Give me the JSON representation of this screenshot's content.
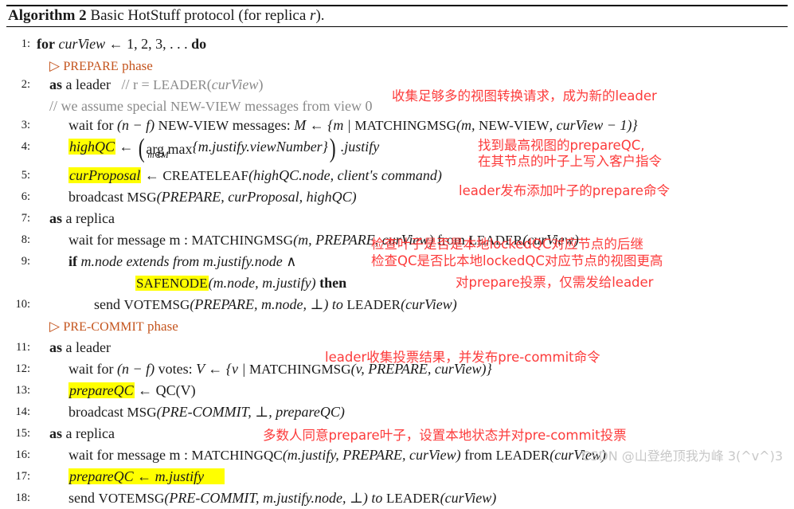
{
  "algorithm": {
    "title_prefix": "Algorithm 2",
    "title_rest": " Basic HotStuff protocol (for replica ",
    "title_var": "r",
    "title_suffix": ")."
  },
  "phases": {
    "prepare": "PREPARE",
    "prepare_suffix": " phase",
    "precommit": "PRE-COMMIT",
    "precommit_suffix": " phase",
    "marker": "▷"
  },
  "lines": [
    {
      "num": "1:",
      "text": "for curView ← 1, 2, 3, . . . do"
    },
    {
      "num": "",
      "text": "▷ PREPARE phase"
    },
    {
      "num": "2:",
      "text": "as a leader   // r = LEADER(curView)"
    },
    {
      "num": "",
      "text": "// we assume special NEW-VIEW messages from view 0"
    },
    {
      "num": "3:",
      "text": "wait for (n − f) NEW-VIEW messages: M ← {m | MATCHINGMSG(m, NEW-VIEW, curView − 1)}"
    },
    {
      "num": "4:",
      "text": "highQC ← ( arg max m∈M {m.justify.viewNumber} ) .justify"
    },
    {
      "num": "5:",
      "text": "curProposal ← CREATELEAF(highQC.node, client's command)"
    },
    {
      "num": "6:",
      "text": "broadcast MSG(PREPARE, curProposal, highQC)"
    },
    {
      "num": "7:",
      "text": "as a replica"
    },
    {
      "num": "8:",
      "text": "wait for message m : MATCHINGMSG(m, PREPARE, curView) from LEADER(curView)"
    },
    {
      "num": "9:",
      "text": "if m.node extends from m.justify.node ∧"
    },
    {
      "num": "",
      "text": "SAFENODE(m.node, m.justify) then"
    },
    {
      "num": "10:",
      "text": "send VOTEMSG(PREPARE, m.node, ⊥) to LEADER(curView)"
    },
    {
      "num": "",
      "text": "▷ PRE-COMMIT phase"
    },
    {
      "num": "11:",
      "text": "as a leader"
    },
    {
      "num": "12:",
      "text": "wait for (n − f) votes: V ← {v | MATCHINGMSG(v, PREPARE, curView)}"
    },
    {
      "num": "13:",
      "text": "prepareQC ← QC(V)"
    },
    {
      "num": "14:",
      "text": "broadcast MSG(PRE-COMMIT, ⊥, prepareQC)"
    },
    {
      "num": "15:",
      "text": "as a replica"
    },
    {
      "num": "16:",
      "text": "wait for message m : MATCHINGQC(m.justify, PREPARE, curView) from LEADER(curView)"
    },
    {
      "num": "17:",
      "text": "prepareQC ← m.justify"
    },
    {
      "num": "18:",
      "text": "send VOTEMSG(PRE-COMMIT, m.justify.node, ⊥) to LEADER(curView)"
    }
  ],
  "line_numbers": {
    "n1": "1:",
    "n2": "2:",
    "n3": "3:",
    "n4": "4:",
    "n5": "5:",
    "n6": "6:",
    "n7": "7:",
    "n8": "8:",
    "n9": "9:",
    "n10": "10:",
    "n11": "11:",
    "n12": "12:",
    "n13": "13:",
    "n14": "14:",
    "n15": "15:",
    "n16": "16:",
    "n17": "17:",
    "n18": "18:"
  },
  "tokens": {
    "for": "for",
    "do": "do",
    "as": "as",
    "a_leader": " a leader",
    "a_replica": " a replica",
    "if": "if",
    "then": "then",
    "curView": "curView",
    "loop_range": " ← 1, 2, 3, . . . ",
    "comment_leader": "// r = ",
    "LEADER": "LEADER",
    "comment_newview_a": "// we assume special ",
    "NEW_VIEW": "NEW-VIEW",
    "comment_newview_b": " messages from view 0",
    "wait_for": "wait for ",
    "nf": "(n − f) ",
    "newview_messages": " messages: ",
    "M_assign": "M ← {m | ",
    "MATCHINGMSG": "MATCHINGMSG",
    "matching_args_3": "(m, ",
    "curview_minus1": ", curView − 1)}",
    "highQC": "highQC",
    "arrow": " ← ",
    "argmax": "arg max",
    "argmax_sub": "m∈M",
    "argmax_body": "{m.justify.viewNumber}",
    "dot_justify": " .justify",
    "curProposal": "curProposal",
    "CREATELEAF": "CREATELEAF",
    "createleaf_args": "(highQC.node, client's command)",
    "broadcast": "broadcast ",
    "MSG": "MSG",
    "prepare_args": "(PREPARE, curProposal, highQC)",
    "wait_msg_m": "wait for message m : ",
    "matchingmsg_prepare": "(m, PREPARE, curView)",
    "from_leader": " from ",
    "leader_curview": "(curView)",
    "if_body": " m.node extends from m.justify.node ∧",
    "SAFENODE": "SAFENODE",
    "safenode_args": "(m.node, m.justify) ",
    "send": "send ",
    "VOTEMSG": "VOTEMSG",
    "votemsg_prepare_args": "(PREPARE, m.node, ⊥) to ",
    "wait_votes": "wait for ",
    "votes_label": "votes: ",
    "V_assign": "V ← {v | ",
    "matchingmsg_v": "(v, PREPARE, curView)}",
    "prepareQC": "prepareQC",
    "QC_V": "QC(V)",
    "msg_precommit_args": "(PRE-COMMIT, ⊥, prepareQC)",
    "MATCHINGQC": "MATCHINGQC",
    "matchingqc_args": "(m.justify, PREPARE, curView)",
    "prepareQC_justify": "prepareQC ← m.justify",
    "votemsg_precommit_args": "(PRE-COMMIT, m.justify.node, ⊥) to "
  },
  "annotations": [
    {
      "id": "a1",
      "text": "收集足够多的视图转换请求，成为新的leader"
    },
    {
      "id": "a2",
      "text": "找到最高视图的prepareQC,"
    },
    {
      "id": "a3",
      "text": "在其节点的叶子上写入客户指令"
    },
    {
      "id": "a4",
      "text": "leader发布添加叶子的prepare命令"
    },
    {
      "id": "a5",
      "text": "检查叶子是否是本地lockedQC对应节点的后继"
    },
    {
      "id": "a6",
      "text": "检查QC是否比本地lockedQC对应节点的视图更高"
    },
    {
      "id": "a7",
      "text": "对prepare投票，仅需发给leader"
    },
    {
      "id": "a8",
      "text": "leader收集投票结果，并发布pre-commit命令"
    },
    {
      "id": "a9",
      "text": "多数人同意prepare叶子，设置本地状态并对pre-commit投票"
    }
  ],
  "annotation_map": {
    "a1": "收集足够多的视图转换请求，成为新的leader",
    "a2": "找到最高视图的prepareQC,",
    "a3": "在其节点的叶子上写入客户指令",
    "a4": "leader发布添加叶子的prepare命令",
    "a5": "检查叶子是否是本地lockedQC对应节点的后继",
    "a6": "检查QC是否比本地lockedQC对应节点的视图更高",
    "a7": "对prepare投票，仅需发给leader",
    "a8": "leader收集投票结果，并发布pre-commit命令",
    "a9": "多数人同意prepare叶子，设置本地状态并对pre-commit投票"
  },
  "watermark": {
    "text": "CSDN @山登绝顶我为峰 3(^v^)3"
  },
  "colors": {
    "annotation_red": "#fc3b3b",
    "phase_orange": "#c4541d",
    "highlight_yellow": "#ffff00",
    "comment_gray": "#8a8a8a",
    "watermark_gray": "#c8c8c8"
  }
}
